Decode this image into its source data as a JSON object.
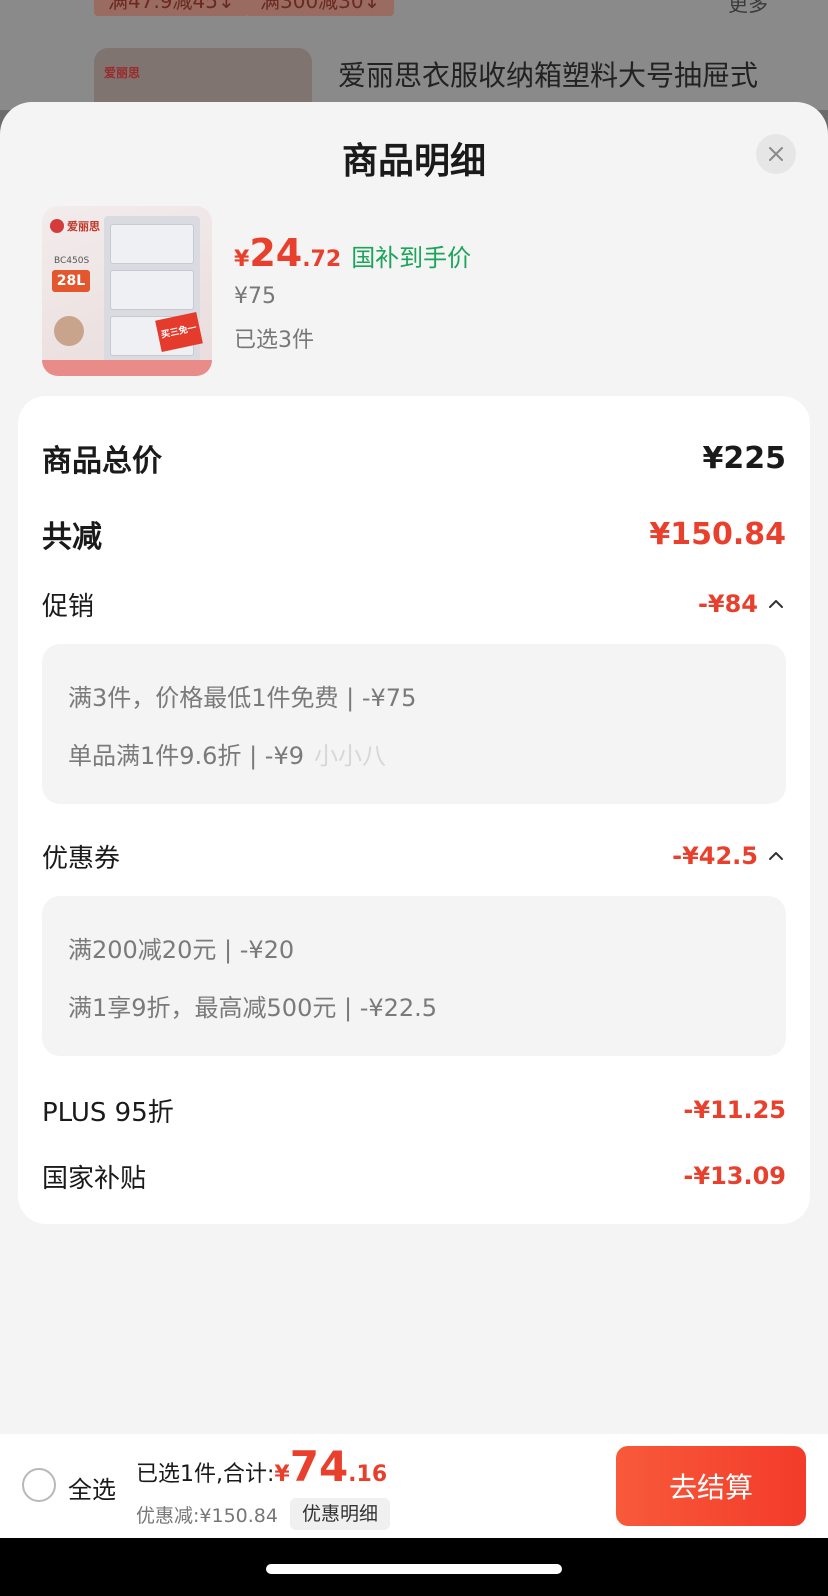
{
  "background": {
    "chips": [
      "满47.9减45↓",
      "满300减30↓"
    ],
    "more_label": "更多",
    "brand_logo": "爱丽思",
    "product_title": "爱丽思衣服收纳箱塑料大号抽屉式"
  },
  "sheet": {
    "title": "商品明细",
    "close_icon": "close-icon"
  },
  "product": {
    "image_text": {
      "logo": "爱丽思",
      "model": "BC450S",
      "size": "28L",
      "tag": "买三免一"
    },
    "price_symbol": "¥",
    "price_int": "24",
    "price_dec": ".72",
    "price_tag": "国补到手价",
    "original_price": "¥75",
    "selected_count": "已选3件"
  },
  "details": {
    "total_label": "商品总价",
    "total_value": "¥225",
    "reduce_label": "共减",
    "reduce_value": "¥150.84",
    "promo": {
      "label": "促销",
      "value": "-¥84",
      "lines": [
        "满3件，价格最低1件免费 | -¥75",
        "单品满1件9.6折 | -¥9"
      ],
      "watermark": "小小八"
    },
    "coupon": {
      "label": "优惠券",
      "value": "-¥42.5",
      "lines": [
        "满200减20元 | -¥20",
        "满1享9折，最高减500元 | -¥22.5"
      ]
    },
    "plus": {
      "label": "PLUS 95折",
      "value": "-¥11.25"
    },
    "subsidy": {
      "label": "国家补贴",
      "value": "-¥13.09"
    }
  },
  "bottom_bar": {
    "select_all": "全选",
    "total_prefix": "已选1件,合计:",
    "total_symbol": "¥",
    "total_int": "74",
    "total_dec": ".16",
    "saved": "优惠减:¥150.84",
    "detail_button": "优惠明细",
    "checkout_button": "去结算"
  },
  "colors": {
    "accent_red": "#e8402c",
    "green": "#1aa55a",
    "panel_bg": "#f4f4f4"
  }
}
